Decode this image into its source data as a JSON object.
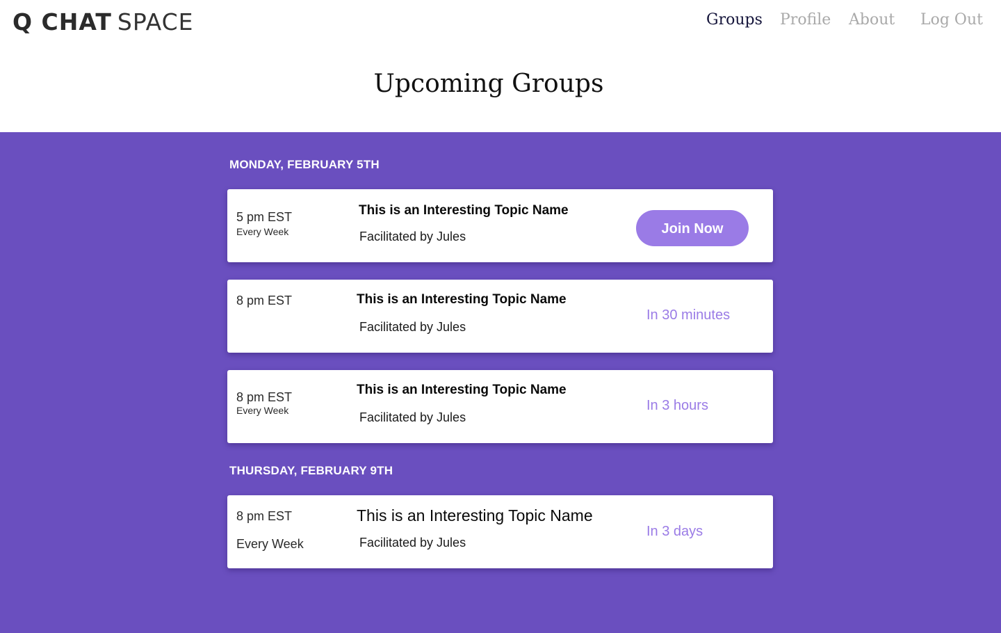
{
  "header": {
    "logo_bold": "Q CHAT",
    "logo_light": "SPACE",
    "nav": {
      "groups": "Groups",
      "profile": "Profile",
      "about": "About",
      "logout": "Log Out"
    }
  },
  "main": {
    "title": "Upcoming Groups",
    "days": [
      {
        "heading": "MONDAY, FEBRUARY 5TH",
        "groups": [
          {
            "time": "5 pm EST",
            "recurrence": "Every Week",
            "topic": "This is an Interesting Topic Name",
            "facilitator": "Facilitated by Jules",
            "action_label": "Join Now"
          },
          {
            "time": "8 pm EST",
            "topic": "This is an Interesting Topic Name",
            "facilitator": "Facilitated by Jules",
            "countdown": "In 30 minutes"
          },
          {
            "time": "8 pm EST",
            "recurrence": "Every Week",
            "topic": "This is an Interesting Topic Name",
            "facilitator": "Facilitated by Jules",
            "countdown": "In 3 hours"
          }
        ]
      },
      {
        "heading": "THURSDAY, FEBRUARY 9TH",
        "groups": [
          {
            "time": "8 pm EST",
            "recurrence": "Every Week",
            "topic": "This is an Interesting Topic Name",
            "facilitator": "Facilitated by Jules",
            "countdown": "In 3 days"
          }
        ]
      }
    ]
  },
  "colors": {
    "purple_background": "#6a4fbf",
    "accent": "#9a7be6",
    "nav_active": "#14143a",
    "nav_inactive": "#a9a9a9"
  }
}
